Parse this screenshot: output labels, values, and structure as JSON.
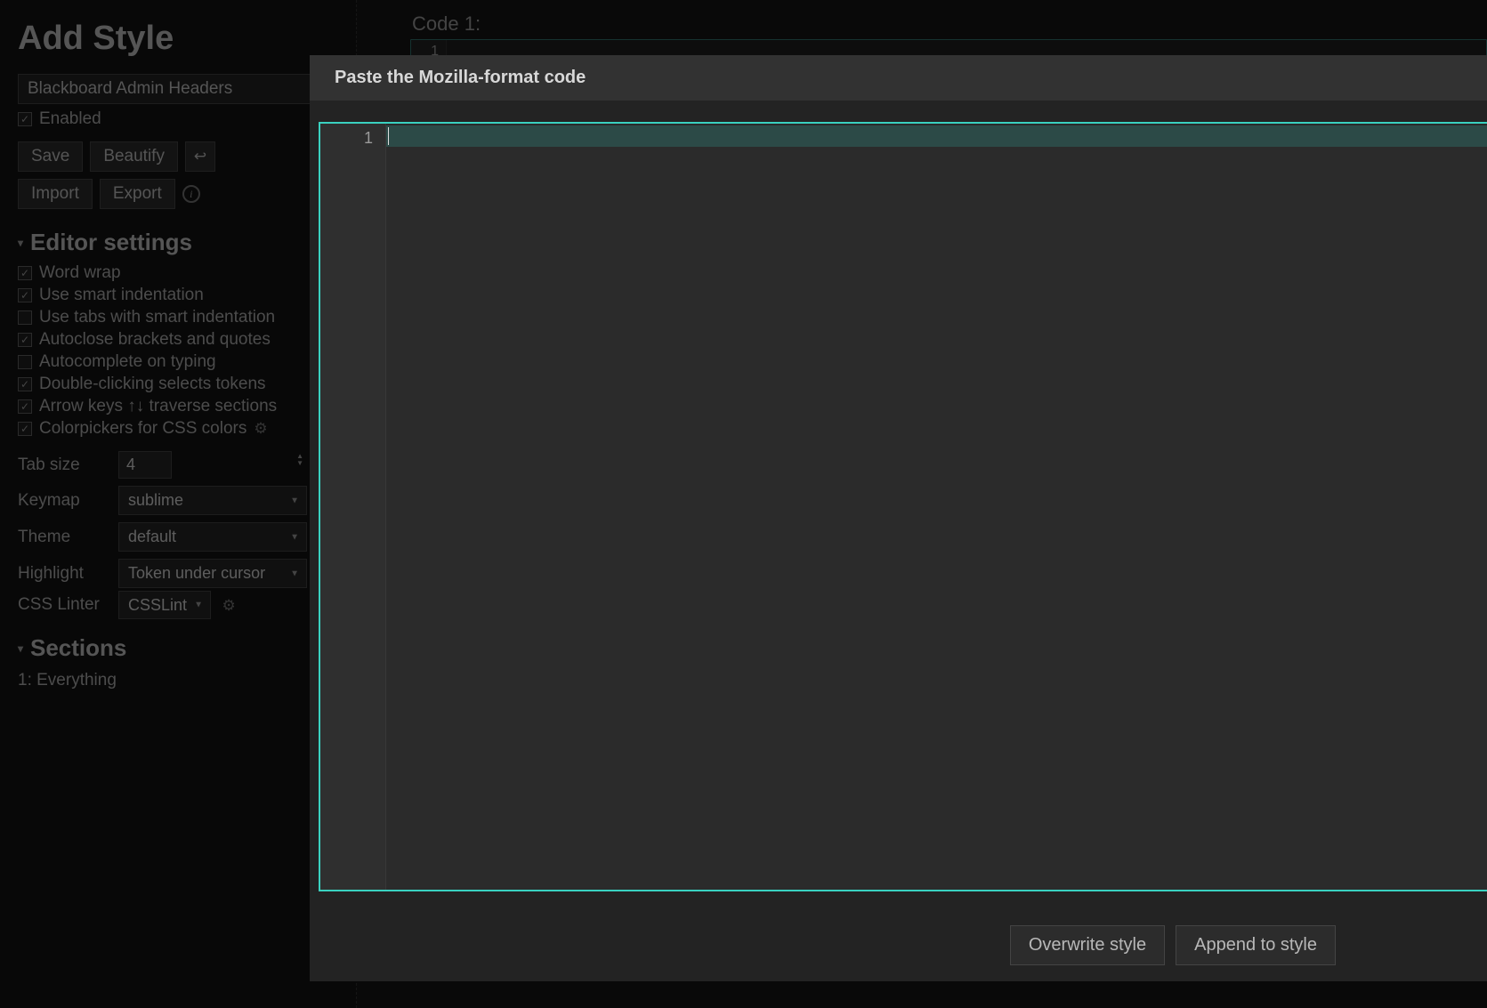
{
  "page_title": "Add Style",
  "style_name": "Blackboard Admin Headers",
  "enabled": {
    "label": "Enabled",
    "checked": true
  },
  "buttons": {
    "save": "Save",
    "beautify": "Beautify",
    "wrap_icon": "↩",
    "import": "Import",
    "export": "Export"
  },
  "editor_settings": {
    "title": "Editor settings",
    "options": [
      {
        "label": "Word wrap",
        "checked": true
      },
      {
        "label": "Use smart indentation",
        "checked": true
      },
      {
        "label": "Use tabs with smart indentation",
        "checked": false
      },
      {
        "label": "Autoclose brackets and quotes",
        "checked": true
      },
      {
        "label": "Autocomplete on typing",
        "checked": false
      },
      {
        "label": "Double-clicking selects tokens",
        "checked": true
      },
      {
        "label": "Arrow keys ↑↓ traverse sections",
        "checked": true
      },
      {
        "label": "Colorpickers for CSS colors",
        "checked": true,
        "gear": true
      }
    ],
    "fields": {
      "tab_size": {
        "label": "Tab size",
        "value": "4"
      },
      "keymap": {
        "label": "Keymap",
        "value": "sublime"
      },
      "theme": {
        "label": "Theme",
        "value": "default"
      },
      "highlight": {
        "label": "Highlight",
        "value": "Token under cursor"
      },
      "linter": {
        "label": "CSS Linter",
        "value": "CSSLint"
      }
    }
  },
  "sections": {
    "title": "Sections",
    "items": [
      "1: Everything"
    ]
  },
  "main": {
    "code_label": "Code 1:",
    "line_number": "1"
  },
  "modal": {
    "title": "Paste the Mozilla-format code",
    "line_number": "1",
    "overwrite": "Overwrite style",
    "append": "Append to style"
  }
}
